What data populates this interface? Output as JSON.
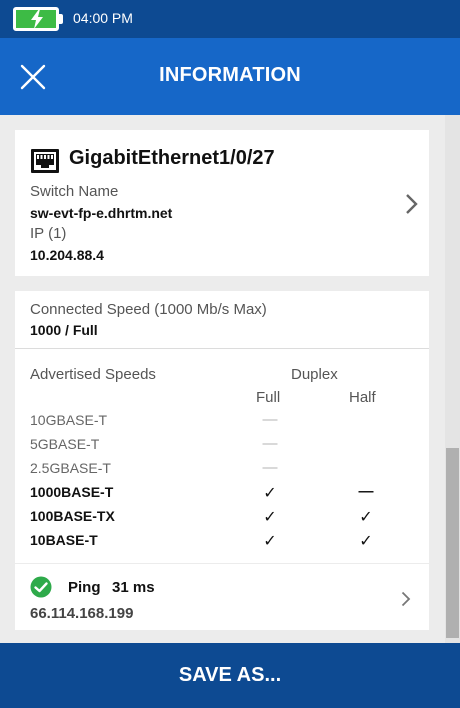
{
  "status_bar": {
    "time": "04:00 PM",
    "battery_color": "#3dbb45"
  },
  "header": {
    "title": "INFORMATION",
    "close_icon": "close-icon",
    "color": "#1667c8"
  },
  "port_card": {
    "port_name": "GigabitEthernet1/0/27",
    "switch_name_label": "Switch Name",
    "switch_name": "sw-evt-fp-e.dhrtm.net",
    "ip_label": "IP (1)",
    "ip": "10.204.88.4"
  },
  "speed_card": {
    "connected_label": "Connected Speed (1000 Mb/s Max)",
    "connected_value": "1000 / Full",
    "advertised_label": "Advertised Speeds",
    "duplex_label": "Duplex",
    "full_label": "Full",
    "half_label": "Half",
    "speeds": [
      {
        "name": "10GBASE-T",
        "full": "—",
        "half": "",
        "active": false
      },
      {
        "name": "5GBASE-T",
        "full": "—",
        "half": "",
        "active": false
      },
      {
        "name": "2.5GBASE-T",
        "full": "—",
        "half": "",
        "active": false
      },
      {
        "name": "1000BASE-T",
        "full": "✓",
        "half": "—",
        "active": true
      },
      {
        "name": "100BASE-TX",
        "full": "✓",
        "half": "✓",
        "active": true
      },
      {
        "name": "10BASE-T",
        "full": "✓",
        "half": "✓",
        "active": true
      }
    ]
  },
  "ping_card": {
    "label": "Ping",
    "time": "31 ms",
    "address": "66.114.168.199",
    "status_color": "#2eaa4a"
  },
  "footer": {
    "save_label": "SAVE AS..."
  }
}
